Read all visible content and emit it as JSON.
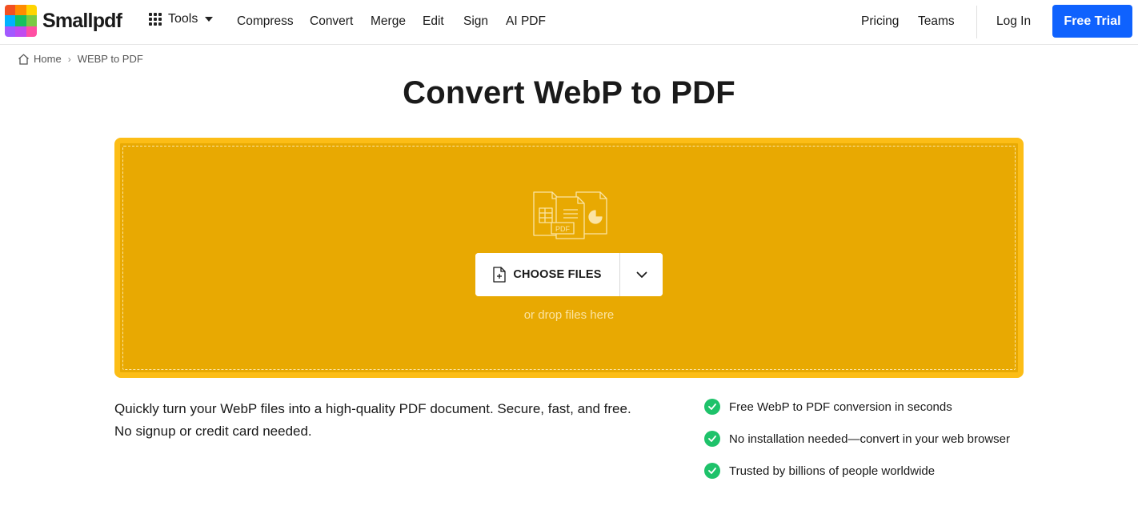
{
  "brand": {
    "name": "Smallpdf",
    "logo_colors": [
      "#f25022",
      "#ff8c00",
      "#ffd400",
      "#00b2ff",
      "#16c060",
      "#7ac943",
      "#a259ff",
      "#c04cf0",
      "#ff4fa3"
    ]
  },
  "nav": {
    "tools_label": "Tools",
    "links": [
      "Compress",
      "Convert",
      "Merge",
      "Edit",
      "Sign",
      "AI PDF"
    ],
    "pricing": "Pricing",
    "teams": "Teams",
    "login": "Log In",
    "free_trial": "Free Trial"
  },
  "breadcrumb": {
    "home": "Home",
    "separator": "›",
    "current": "WEBP to PDF"
  },
  "title": "Convert WebP to PDF",
  "dropzone": {
    "choose_label": "CHOOSE FILES",
    "hint": "or drop files here",
    "illustration_label": "PDF",
    "background_color": "#e8a902",
    "border_color": "#fcbd16"
  },
  "description": {
    "line1": "Quickly turn your WebP files into a high-quality PDF document. Secure, fast, and free.",
    "line2": "No signup or credit card needed."
  },
  "features": [
    "Free WebP to PDF conversion in seconds",
    "No installation needed—convert in your web browser",
    "Trusted by billions of people worldwide"
  ],
  "colors": {
    "accent_blue": "#0f62fe",
    "check_green": "#1ec26a"
  }
}
